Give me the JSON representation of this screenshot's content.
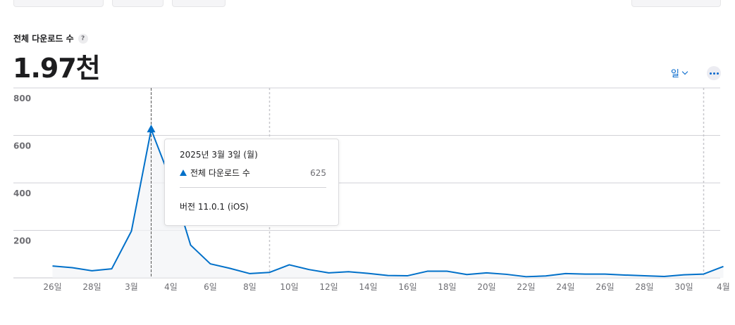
{
  "metric": {
    "label": "전체 다운로드 수",
    "help_glyph": "?",
    "total": "1.97천"
  },
  "controls": {
    "period_label": "일"
  },
  "tooltip": {
    "date": "2025년 3월 3일 (월)",
    "series_label": "전체 다운로드 수",
    "value": "625",
    "version": "버전 11.0.1 (iOS)"
  },
  "colors": {
    "accent": "#0070c9",
    "link": "#0066cc",
    "grid": "#d2d2d7",
    "tick_text": "#6e6e73"
  },
  "chart_data": {
    "type": "line",
    "ylim": [
      0,
      800
    ],
    "yticks": [
      200,
      400,
      600,
      800
    ],
    "ytick_labels": [
      "200",
      "400",
      "600",
      "800"
    ],
    "x_tick_labels": [
      "26일",
      "28일",
      "3월",
      "4일",
      "6일",
      "8일",
      "10일",
      "12일",
      "14일",
      "16일",
      "18일",
      "20일",
      "22일",
      "24일",
      "26일",
      "28일",
      "30일",
      "4월"
    ],
    "highlight": {
      "date": "3월 3일",
      "value": 625
    },
    "version_markers": [
      "3월 9일",
      "3월 31일"
    ],
    "series": [
      {
        "dates": [
          "2월 26일",
          "2월 27일",
          "2월 28일",
          "3월 1일",
          "3월 2일",
          "3월 3일",
          "3월 4일",
          "3월 5일",
          "3월 6일",
          "3월 7일",
          "3월 8일",
          "3월 9일",
          "3월 10일",
          "3월 11일",
          "3월 12일",
          "3월 13일",
          "3월 14일",
          "3월 15일",
          "3월 16일",
          "3월 17일",
          "3월 18일",
          "3월 19일",
          "3월 20일",
          "3월 21일",
          "3월 22일",
          "3월 23일",
          "3월 24일",
          "3월 25일",
          "3월 26일",
          "3월 27일",
          "3월 28일",
          "3월 29일",
          "3월 30일",
          "3월 31일",
          "4월 1일"
        ],
        "values": [
          50,
          43,
          30,
          38,
          197,
          625,
          410,
          138,
          59,
          40,
          18,
          23,
          55,
          35,
          21,
          26,
          19,
          10,
          9,
          28,
          28,
          14,
          21,
          15,
          5,
          8,
          18,
          16,
          16,
          12,
          9,
          6,
          13,
          16,
          48
        ]
      }
    ]
  }
}
